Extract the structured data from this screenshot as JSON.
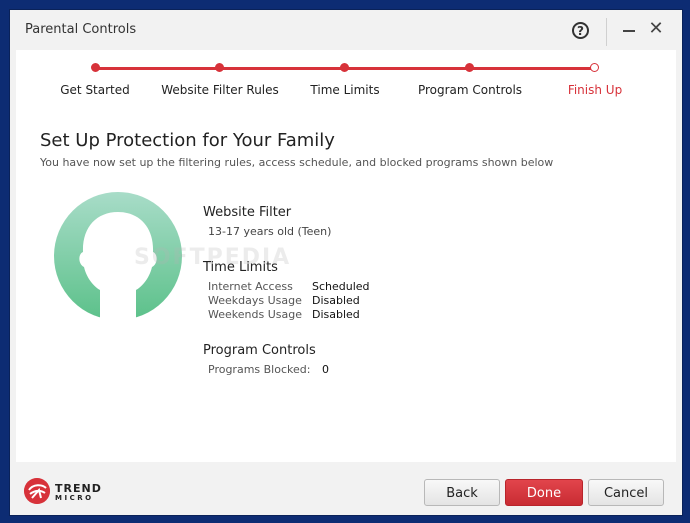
{
  "window": {
    "title": "Parental Controls",
    "help_glyph": "?",
    "minimize_glyph": "",
    "close_glyph": "✕"
  },
  "steps": [
    {
      "label": "Get Started",
      "active": false
    },
    {
      "label": "Website Filter Rules",
      "active": false
    },
    {
      "label": "Time Limits",
      "active": false
    },
    {
      "label": "Program Controls",
      "active": false
    },
    {
      "label": "Finish Up",
      "active": true
    }
  ],
  "main": {
    "heading": "Set Up Protection for Your Family",
    "subheading": "You have now set up the filtering rules, access schedule, and blocked programs shown below"
  },
  "website_filter": {
    "title": "Website Filter",
    "value": "13-17 years old (Teen)"
  },
  "time_limits": {
    "title": "Time Limits",
    "rows": [
      {
        "key": "Internet Access",
        "value": "Scheduled"
      },
      {
        "key": "Weekdays Usage",
        "value": "Disabled"
      },
      {
        "key": "Weekends Usage",
        "value": "Disabled"
      }
    ]
  },
  "program_controls": {
    "title": "Program Controls",
    "blocked_label": "Programs Blocked:",
    "blocked_count": "0"
  },
  "watermark": "SOFTPEDIA",
  "footer": {
    "logo_line1": "TREND",
    "logo_line2": "MICRO",
    "back_label": "Back",
    "done_label": "Done",
    "cancel_label": "Cancel"
  },
  "colors": {
    "accent": "#d7323a",
    "avatar_top": "#a8dcc8",
    "avatar_bottom": "#5cc18a"
  },
  "icons": {
    "help": "help-icon",
    "minimize": "minimize-icon",
    "close": "close-icon",
    "avatar": "child-avatar-icon",
    "logo": "trend-micro-logo"
  }
}
